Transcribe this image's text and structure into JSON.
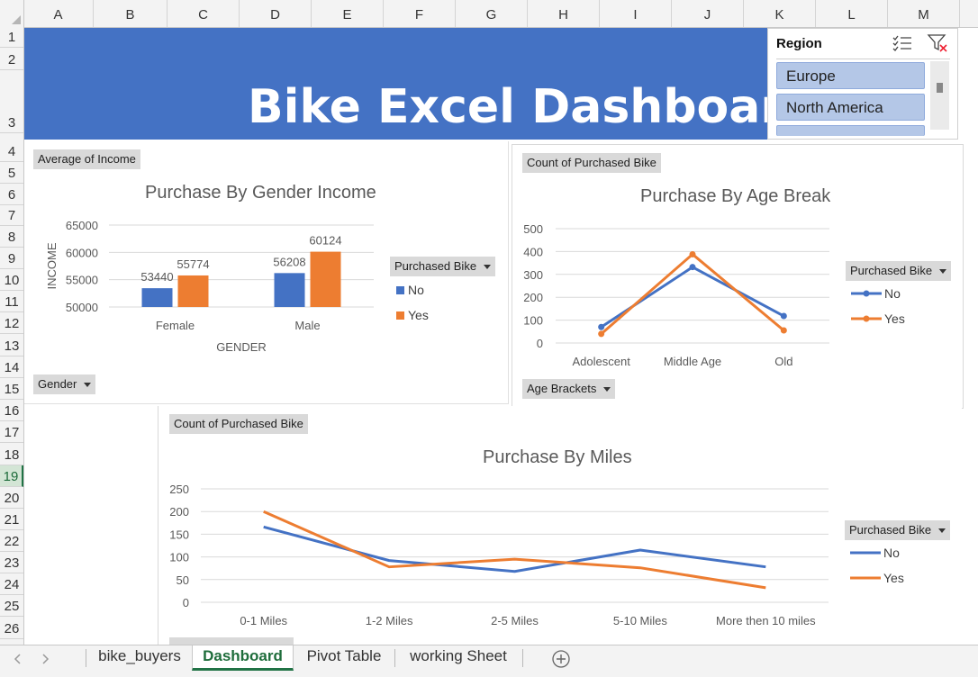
{
  "sheet": {
    "columns": [
      "A",
      "B",
      "C",
      "D",
      "E",
      "F",
      "G",
      "H",
      "I",
      "J",
      "K",
      "L",
      "M"
    ],
    "rows": [
      "1",
      "2",
      "3",
      "4",
      "5",
      "6",
      "7",
      "8",
      "9",
      "10",
      "11",
      "12",
      "13",
      "14",
      "15",
      "16",
      "17",
      "18",
      "19",
      "20",
      "21",
      "22",
      "23",
      "24",
      "25",
      "26"
    ],
    "selected_row": "19"
  },
  "banner": {
    "title": "Bike Excel Dashboard"
  },
  "slicer": {
    "title": "Region",
    "items": [
      "Europe",
      "North America"
    ],
    "icons": [
      "multi-select-icon",
      "clear-filter-icon"
    ]
  },
  "chart1": {
    "field_value": "Average of Income",
    "field_axis": "Gender",
    "legend_field": "Purchased Bike",
    "legend_items": [
      "No",
      "Yes"
    ]
  },
  "chart2": {
    "field_value": "Count of Purchased Bike",
    "field_axis": "Age Brackets",
    "legend_field": "Purchased Bike",
    "legend_items": [
      "No",
      "Yes"
    ]
  },
  "chart3": {
    "field_value": "Count of Purchased Bike",
    "legend_field": "Purchased Bike",
    "legend_items": [
      "No",
      "Yes"
    ]
  },
  "colors": {
    "no": "#4472c4",
    "yes": "#ed7d31",
    "banner": "#4472c4",
    "excel_green": "#217346"
  },
  "chart_data": [
    {
      "type": "bar",
      "title": "Purchase By Gender Income",
      "xlabel": "GENDER",
      "ylabel": "INCOME",
      "categories": [
        "Female",
        "Male"
      ],
      "series": [
        {
          "name": "No",
          "values": [
            53440,
            56208
          ]
        },
        {
          "name": "Yes",
          "values": [
            55774,
            60124
          ]
        }
      ],
      "ylim": [
        50000,
        65000
      ],
      "yticks": [
        "50000",
        "55000",
        "60000",
        "65000"
      ],
      "data_labels": true,
      "grid": true,
      "legend": "right"
    },
    {
      "type": "line",
      "title": "Purchase By Age Break",
      "xlabel": "",
      "ylabel": "",
      "categories": [
        "Adolescent",
        "Middle Age",
        "Old"
      ],
      "series": [
        {
          "name": "No",
          "values": [
            70,
            332,
            118
          ]
        },
        {
          "name": "Yes",
          "values": [
            40,
            388,
            55
          ]
        }
      ],
      "ylim": [
        0,
        500
      ],
      "yticks": [
        "0",
        "100",
        "200",
        "300",
        "400",
        "500"
      ],
      "markers": true,
      "grid": true,
      "legend": "right"
    },
    {
      "type": "line",
      "title": "Purchase By Miles",
      "xlabel": "",
      "ylabel": "",
      "categories": [
        "0-1 Miles",
        "1-2 Miles",
        "2-5 Miles",
        "5-10 Miles",
        "More then 10 miles"
      ],
      "series": [
        {
          "name": "No",
          "values": [
            166,
            92,
            68,
            115,
            78
          ]
        },
        {
          "name": "Yes",
          "values": [
            200,
            78,
            95,
            76,
            32
          ]
        }
      ],
      "ylim": [
        0,
        250
      ],
      "yticks": [
        "0",
        "50",
        "100",
        "150",
        "200",
        "250"
      ],
      "markers": false,
      "grid": true,
      "legend": "right"
    }
  ],
  "tabs": {
    "items": [
      "bike_buyers",
      "Dashboard",
      "Pivot Table",
      "working Sheet"
    ],
    "active": "Dashboard"
  }
}
